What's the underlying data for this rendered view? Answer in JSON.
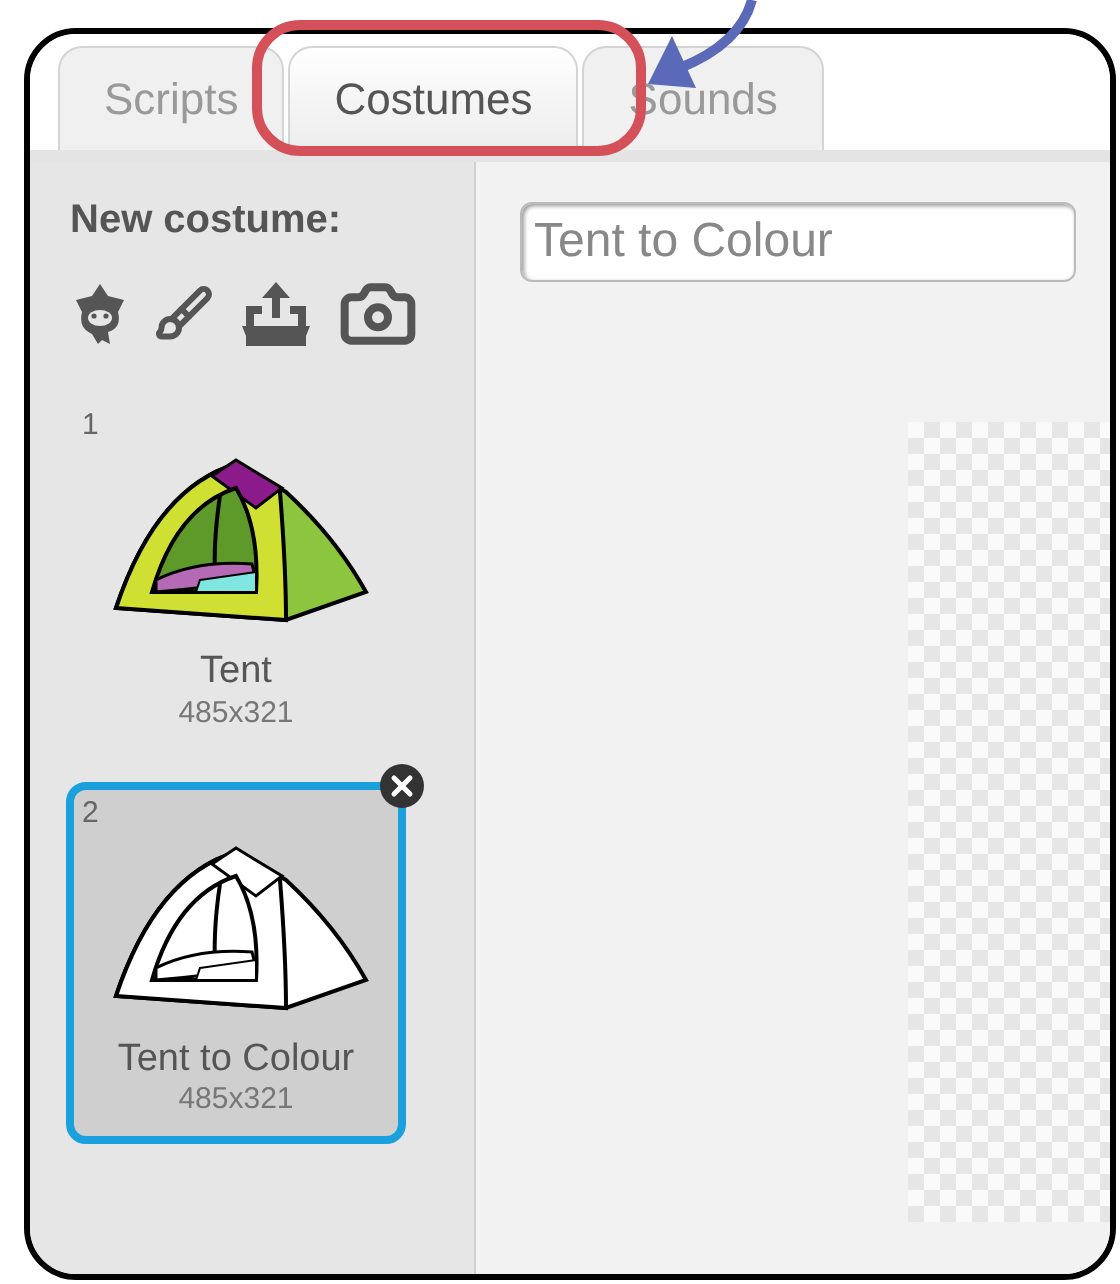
{
  "tabs": [
    {
      "label": "Scripts",
      "selected": false
    },
    {
      "label": "Costumes",
      "selected": true
    },
    {
      "label": "Sounds",
      "selected": false
    }
  ],
  "sidebar": {
    "heading": "New costume:"
  },
  "costumes": [
    {
      "number": "1",
      "name": "Tent",
      "size": "485x321",
      "kind": "colored",
      "selected": false
    },
    {
      "number": "2",
      "name": "Tent to Colour",
      "size": "485x321",
      "kind": "outline",
      "selected": true
    }
  ],
  "name_field": {
    "value": "Tent to Colour"
  }
}
